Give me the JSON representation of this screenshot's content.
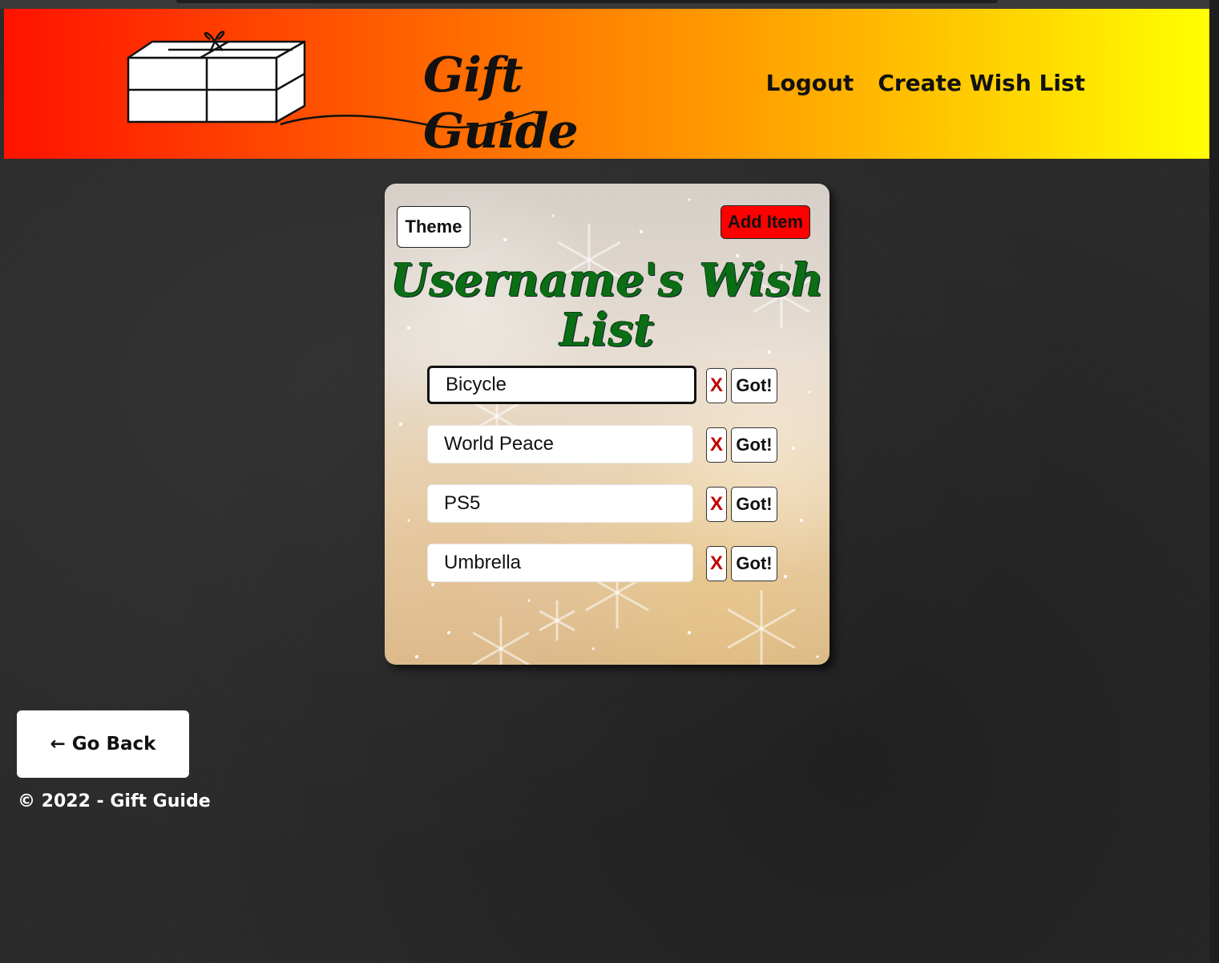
{
  "header": {
    "logo_text": "Gift Guide",
    "nav": {
      "logout": "Logout",
      "create_wish_list": "Create Wish List"
    },
    "colors": {
      "gradient_start": "#ff1200",
      "gradient_end": "#ffff00"
    }
  },
  "card": {
    "theme_label": "Theme",
    "add_item_label": "Add Item",
    "title": "Username's Wish List",
    "items": [
      {
        "value": "Bicycle",
        "remove_label": "X",
        "got_label": "Got!"
      },
      {
        "value": "World Peace",
        "remove_label": "X",
        "got_label": "Got!"
      },
      {
        "value": "PS5",
        "remove_label": "X",
        "got_label": "Got!"
      },
      {
        "value": "Umbrella",
        "remove_label": "X",
        "got_label": "Got!"
      }
    ],
    "colors": {
      "title": "#0b6e14",
      "add_item_bg": "#ff0000",
      "remove_x": "#c00000"
    }
  },
  "go_back_label": "← Go Back",
  "footer_text": "© 2022 - Gift Guide"
}
